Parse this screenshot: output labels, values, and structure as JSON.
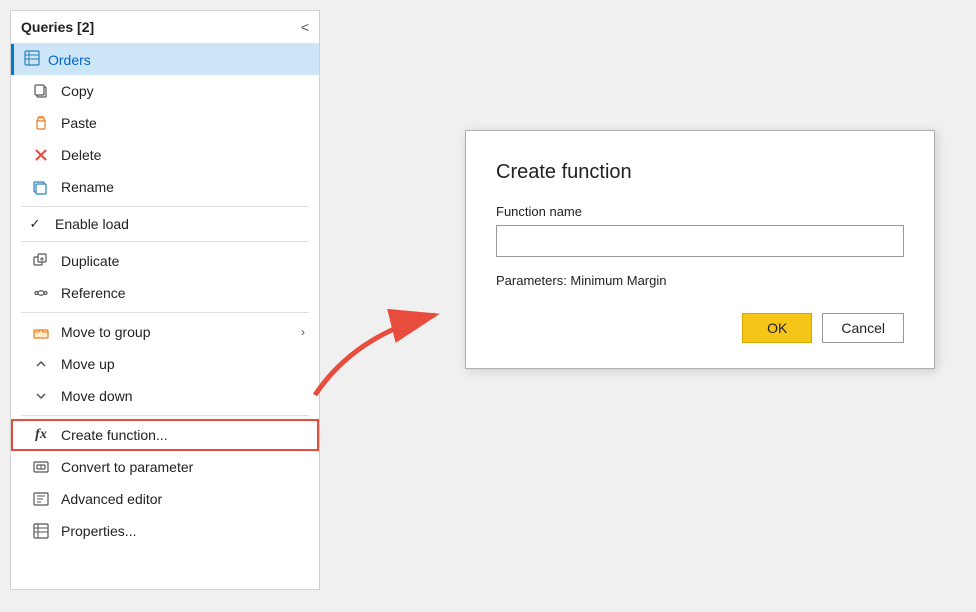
{
  "panel": {
    "title": "Queries [2]",
    "collapseLabel": "<",
    "queryItem": {
      "label": "Orders"
    },
    "menuItems": [
      {
        "id": "copy",
        "label": "Copy",
        "icon": "copy",
        "hasCheck": false,
        "hasSub": false
      },
      {
        "id": "paste",
        "label": "Paste",
        "icon": "paste",
        "hasCheck": false,
        "hasSub": false
      },
      {
        "id": "delete",
        "label": "Delete",
        "icon": "delete",
        "hasCheck": false,
        "hasSub": false
      },
      {
        "id": "rename",
        "label": "Rename",
        "icon": "rename",
        "hasCheck": false,
        "hasSub": false
      },
      {
        "id": "enable-load",
        "label": "Enable load",
        "icon": "",
        "hasCheck": true,
        "hasSub": false
      },
      {
        "id": "duplicate",
        "label": "Duplicate",
        "icon": "duplicate",
        "hasCheck": false,
        "hasSub": false
      },
      {
        "id": "reference",
        "label": "Reference",
        "icon": "reference",
        "hasCheck": false,
        "hasSub": false
      },
      {
        "id": "move-to-group",
        "label": "Move to group",
        "icon": "movegroup",
        "hasCheck": false,
        "hasSub": true
      },
      {
        "id": "move-up",
        "label": "Move up",
        "icon": "moveup",
        "hasCheck": false,
        "hasSub": false
      },
      {
        "id": "move-down",
        "label": "Move down",
        "icon": "movedown",
        "hasCheck": false,
        "hasSub": false
      },
      {
        "id": "create-function",
        "label": "Create function...",
        "icon": "fx",
        "hasCheck": false,
        "hasSub": false,
        "highlighted": true
      },
      {
        "id": "convert-to-param",
        "label": "Convert to parameter",
        "icon": "convert",
        "hasCheck": false,
        "hasSub": false
      },
      {
        "id": "advanced-editor",
        "label": "Advanced editor",
        "icon": "advanced",
        "hasCheck": false,
        "hasSub": false
      },
      {
        "id": "properties",
        "label": "Properties...",
        "icon": "properties",
        "hasCheck": false,
        "hasSub": false
      }
    ]
  },
  "dialog": {
    "title": "Create function",
    "fieldLabel": "Function name",
    "fieldPlaceholder": "",
    "paramsLabel": "Parameters: Minimum Margin",
    "okLabel": "OK",
    "cancelLabel": "Cancel"
  }
}
